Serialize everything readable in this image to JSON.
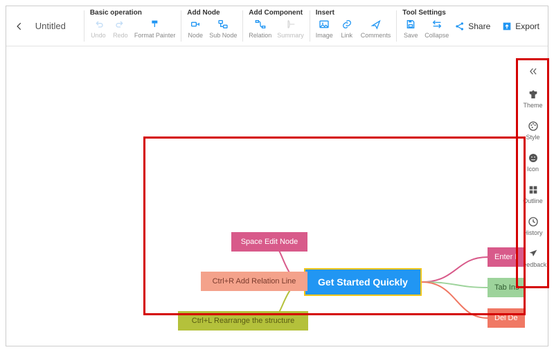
{
  "doc": {
    "title": "Untitled"
  },
  "toolbar": {
    "groups": {
      "basic": {
        "label": "Basic operation",
        "undo": "Undo",
        "redo": "Redo",
        "format_painter": "Format Painter"
      },
      "addnode": {
        "label": "Add Node",
        "node": "Node",
        "subnode": "Sub Node"
      },
      "addcomp": {
        "label": "Add Component",
        "relation": "Relation",
        "summary": "Summary"
      },
      "insert": {
        "label": "Insert",
        "image": "Image",
        "link": "Link",
        "comments": "Comments"
      },
      "toolset": {
        "label": "Tool Settings",
        "save": "Save",
        "collapse": "Collapse"
      }
    },
    "share": "Share",
    "export": "Export"
  },
  "sidepanel": {
    "theme": "Theme",
    "style": "Style",
    "icon": "Icon",
    "outline": "Outline",
    "history": "History",
    "feedback": "Feedback"
  },
  "mindmap": {
    "center": "Get Started Quickly",
    "left": [
      "Space Edit Node",
      "Ctrl+R Add Relation Line",
      "Ctrl+L Rearrange the structure"
    ],
    "right": [
      "Enter I",
      "Tab Ins",
      "Del De"
    ]
  }
}
